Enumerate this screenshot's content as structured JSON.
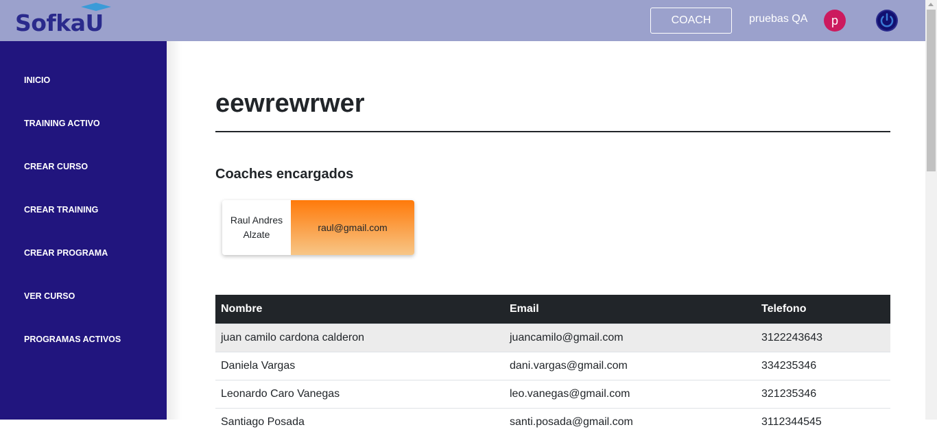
{
  "header": {
    "logo_text": "SofkaU",
    "role_button": "COACH",
    "username": "pruebas QA",
    "avatar_initial": "p",
    "colors": {
      "bar": "#9ba1cc",
      "avatar": "#cc1a5e",
      "power": "#2a2a8c"
    },
    "icons": {
      "power": "power-icon",
      "cap": "graduation-cap-icon"
    }
  },
  "sidebar": {
    "color": "#21157e",
    "items": [
      {
        "label": "INICIO"
      },
      {
        "label": "TRAINING ACTIVO"
      },
      {
        "label": "CREAR CURSO"
      },
      {
        "label": "CREAR TRAINING"
      },
      {
        "label": "CREAR PROGRAMA"
      },
      {
        "label": "VER CURSO"
      },
      {
        "label": "PROGRAMAS ACTIVOS"
      }
    ]
  },
  "main": {
    "title": "eewrewrwer",
    "coaches_heading": "Coaches encargados",
    "coach": {
      "name": "Raul Andres Alzate",
      "email": "raul@gmail.com"
    },
    "table": {
      "headers": [
        "Nombre",
        "Email",
        "Telefono"
      ],
      "rows": [
        [
          "juan camilo cardona calderon",
          "juancamilo@gmail.com",
          "3122243643"
        ],
        [
          "Daniela Vargas",
          "dani.vargas@gmail.com",
          "334235346"
        ],
        [
          "Leonardo Caro Vanegas",
          "leo.vanegas@gmail.com",
          "321235346"
        ],
        [
          "Santiago Posada",
          "santi.posada@gmail.com",
          "3112344545"
        ]
      ]
    }
  }
}
